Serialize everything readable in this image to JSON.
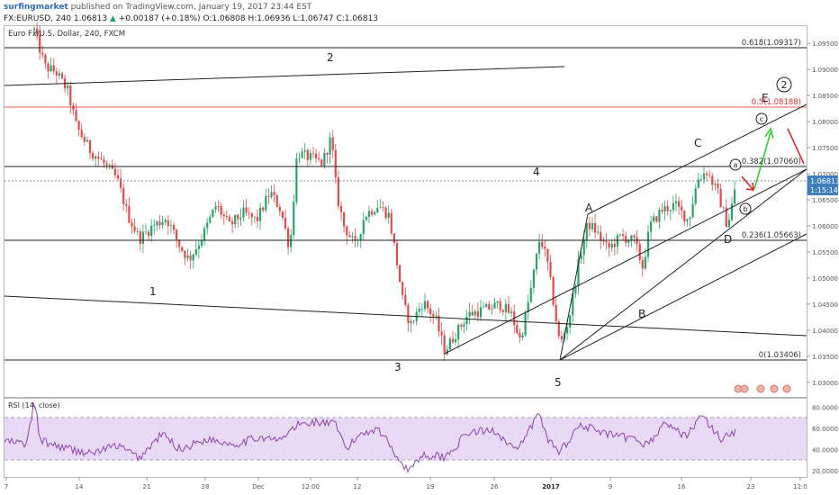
{
  "header": {
    "author": "surfingmarket",
    "published_text": "published on TradingView.com, January 19, 2017 23:44 EST",
    "symbol_line": "FX:EURUSD, 240  1.06813",
    "change_arrow": "▲",
    "change_text": "+0.00187 (+0.18%)",
    "ohlc_text": "O:1.06808 H:1.06936 L:1.06747 C:1.06813"
  },
  "chart_title": "Euro Fx/U.S. Dollar, 240, FXCM",
  "colors": {
    "up": "#2aa36b",
    "down": "#e24b4b",
    "rsi_line": "#8e44ad",
    "rsi_band": "#e8d9f5",
    "fib_red": "#e03030",
    "arrow_green": "#22cc22",
    "arrow_red": "#e02020",
    "last_price_bg": "#3f7fbf"
  },
  "chart_data": {
    "type": "candlestick",
    "price_axis": {
      "ylim": [
        1.0272,
        1.0983
      ],
      "ticks": [
        "1.09500",
        "1.09000",
        "1.08500",
        "1.08000",
        "1.07500",
        "1.07000",
        "1.06500",
        "1.06000",
        "1.05500",
        "1.05000",
        "1.04500",
        "1.04000",
        "1.03500",
        "1.03000"
      ],
      "tick_values": [
        1.095,
        1.09,
        1.085,
        1.08,
        1.075,
        1.07,
        1.065,
        1.06,
        1.055,
        1.05,
        1.045,
        1.04,
        1.035,
        1.03
      ]
    },
    "last_price": {
      "value": 1.06813,
      "label": "1.06813",
      "countdown": "1:15:14"
    },
    "time_axis": {
      "labels": [
        "7",
        "14",
        "21",
        "28",
        "Dec",
        "12:00",
        "12",
        "19",
        "26",
        "2017",
        "9",
        "16",
        "23",
        "12:0"
      ]
    },
    "swing_points_approx": [
      {
        "label": "2",
        "price": 1.0935
      },
      {
        "label": "3",
        "price": 1.0341
      },
      {
        "label": "4",
        "price": 1.0655
      },
      {
        "label": "5",
        "price": 1.0341
      },
      {
        "label": "A",
        "price": 1.0616
      },
      {
        "label": "B",
        "price": 1.0455
      },
      {
        "label": "C",
        "price": 1.0717
      },
      {
        "label": "D",
        "price": 1.059
      }
    ],
    "fib_levels": [
      {
        "label": "0.618(1.09317)",
        "value": 1.09317
      },
      {
        "label": "0.5(1.08188)",
        "value": 1.08188
      },
      {
        "label": "0.382(1.07060)",
        "value": 1.0706
      },
      {
        "label": "0.236(1.05663)",
        "value": 1.05663
      },
      {
        "label": "0(1.03406)",
        "value": 1.03406
      }
    ],
    "wave_labels": [
      "1",
      "2",
      "3",
      "4",
      "5",
      "A",
      "B",
      "C",
      "D",
      "E"
    ],
    "circled_labels": [
      "a",
      "b",
      "c",
      "2"
    ],
    "rsi": {
      "title": "RSI (14, close)",
      "ylim": [
        14,
        88
      ],
      "upper_band": 70,
      "lower_band": 30,
      "ticks": [
        "80.0000",
        "60.0000",
        "40.0000",
        "20.0000"
      ],
      "tick_values": [
        80,
        60,
        40,
        20
      ]
    }
  }
}
